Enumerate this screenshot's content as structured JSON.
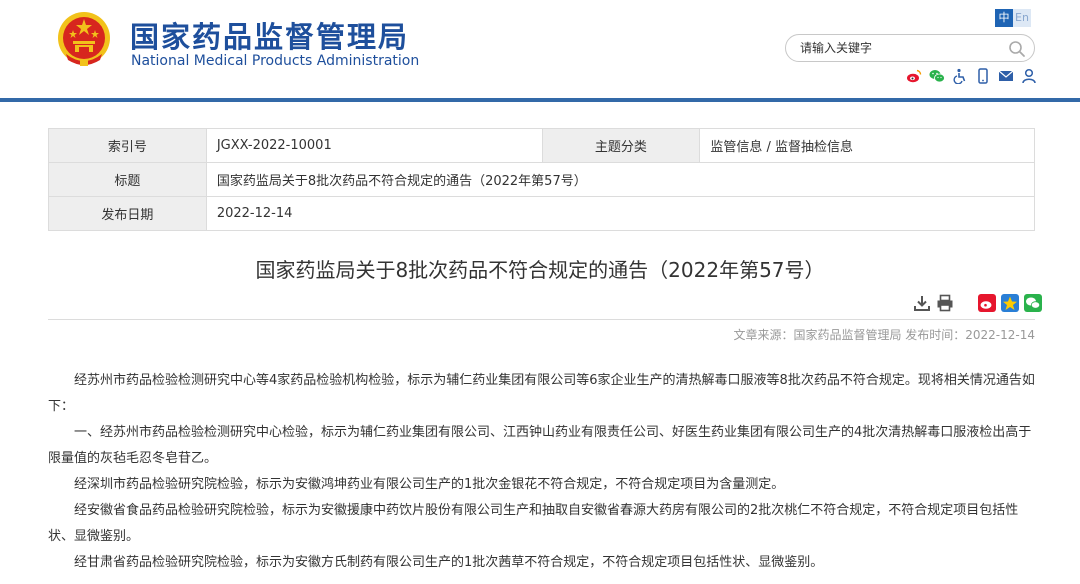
{
  "header": {
    "title_cn": "国家药品监督管理局",
    "title_en": "National Medical Products Administration",
    "lang_cn": "中",
    "lang_en": "En",
    "search_placeholder": "请输入关键字",
    "icons": [
      "weibo-icon",
      "wechat-icon",
      "accessibility-icon",
      "mobile-icon",
      "mail-icon",
      "user-icon"
    ]
  },
  "meta": {
    "index_label": "索引号",
    "index_value": "JGXX-2022-10001",
    "topic_label": "主题分类",
    "topic_value": "监管信息 / 监督抽检信息",
    "title_label": "标题",
    "title_value": "国家药监局关于8批次药品不符合规定的通告（2022年第57号）",
    "date_label": "发布日期",
    "date_value": "2022-12-14"
  },
  "article": {
    "title": "国家药监局关于8批次药品不符合规定的通告（2022年第57号）",
    "source": "文章来源：国家药品监督管理局 发布时间：2022-12-14",
    "paragraphs": [
      "经苏州市药品检验检测研究中心等4家药品检验机构检验，标示为辅仁药业集团有限公司等6家企业生产的清热解毒口服液等8批次药品不符合规定。现将相关情况通告如下：",
      "一、经苏州市药品检验检测研究中心检验，标示为辅仁药业集团有限公司、江西钟山药业有限责任公司、好医生药业集团有限公司生产的4批次清热解毒口服液检出高于限量值的灰毡毛忍冬皂苷乙。",
      "经深圳市药品检验研究院检验，标示为安徽鸿坤药业有限公司生产的1批次金银花不符合规定，不符合规定项目为含量测定。",
      "经安徽省食品药品检验研究院检验，标示为安徽援康中药饮片股份有限公司生产和抽取自安徽省春源大药房有限公司的2批次桃仁不符合规定，不符合规定项目包括性状、显微鉴别。",
      "经甘肃省药品检验研究院检验，标示为安徽方氏制药有限公司生产的1批次茜草不符合规定，不符合规定项目包括性状、显微鉴别。"
    ]
  },
  "colors": {
    "brand_blue": "#1e4f9c",
    "rule_blue": "#3269a8",
    "emblem_red": "#d7261e",
    "emblem_gold": "#f2c21b"
  }
}
